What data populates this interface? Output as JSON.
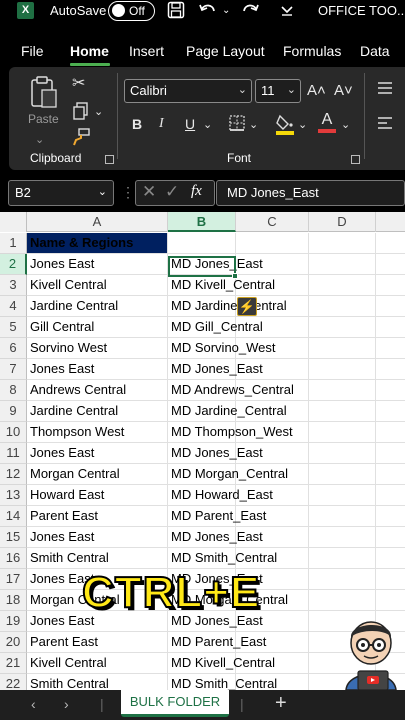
{
  "titlebar": {
    "app_icon": "X",
    "autosave_label": "AutoSave",
    "toggle_text": "Off",
    "save_icon": "save-icon",
    "undo_icon": "undo-icon",
    "redo_icon": "redo-icon",
    "doc_title": "OFFICE TOO..."
  },
  "menu": {
    "tabs": [
      "File",
      "Home",
      "Insert",
      "Page Layout",
      "Formulas",
      "Data"
    ],
    "active": "Home"
  },
  "ribbon": {
    "paste_label": "Paste",
    "clipboard_group": "Clipboard",
    "font_name": "Calibri",
    "font_size": "11",
    "bold": "B",
    "italic": "I",
    "underline": "U",
    "font_group": "Font",
    "grow_font": "A˄",
    "shrink_font": "A˅",
    "font_color_letter": "A",
    "font_color": "#e23b3b",
    "fill_color": "#f5d90a"
  },
  "formula_bar": {
    "cell_ref": "B2",
    "fx": "fx",
    "value": "MD Jones_East"
  },
  "grid": {
    "columns": [
      "A",
      "B",
      "C",
      "D"
    ],
    "selected_column": "B",
    "selected_row": "2",
    "rows": [
      {
        "n": "1",
        "a": "Name & Regions",
        "b": ""
      },
      {
        "n": "2",
        "a": "Jones East",
        "b": "MD Jones_East"
      },
      {
        "n": "3",
        "a": "Kivell Central",
        "b": "MD Kivell_Central"
      },
      {
        "n": "4",
        "a": "Jardine Central",
        "b": "MD Jardine_Central"
      },
      {
        "n": "5",
        "a": "Gill Central",
        "b": "MD Gill_Central"
      },
      {
        "n": "6",
        "a": "Sorvino West",
        "b": "MD Sorvino_West"
      },
      {
        "n": "7",
        "a": "Jones East",
        "b": "MD Jones_East"
      },
      {
        "n": "8",
        "a": "Andrews Central",
        "b": "MD Andrews_Central"
      },
      {
        "n": "9",
        "a": "Jardine Central",
        "b": "MD Jardine_Central"
      },
      {
        "n": "10",
        "a": "Thompson West",
        "b": "MD Thompson_West"
      },
      {
        "n": "11",
        "a": "Jones East",
        "b": "MD Jones_East"
      },
      {
        "n": "12",
        "a": "Morgan Central",
        "b": "MD Morgan_Central"
      },
      {
        "n": "13",
        "a": "Howard East",
        "b": "MD Howard_East"
      },
      {
        "n": "14",
        "a": "Parent East",
        "b": "MD Parent_East"
      },
      {
        "n": "15",
        "a": "Jones East",
        "b": "MD Jones_East"
      },
      {
        "n": "16",
        "a": "Smith Central",
        "b": "MD Smith_Central"
      },
      {
        "n": "17",
        "a": "Jones East",
        "b": "MD Jones_East"
      },
      {
        "n": "18",
        "a": "Morgan Central",
        "b": "MD Morgan_Central"
      },
      {
        "n": "19",
        "a": "Jones East",
        "b": "MD Jones_East"
      },
      {
        "n": "20",
        "a": "Parent East",
        "b": "MD Parent_East"
      },
      {
        "n": "21",
        "a": "Kivell Central",
        "b": "MD Kivell_Central"
      },
      {
        "n": "22",
        "a": "Smith Central",
        "b": "MD Smith_Central"
      }
    ]
  },
  "overlay": {
    "shortcut_text": "CTRL+E",
    "color": "#ffe817"
  },
  "sheets": {
    "active_tab": "BULK FOLDER",
    "add_symbol": "+"
  },
  "colors": {
    "excel_green": "#1e7145",
    "header_fill": "#002060"
  }
}
